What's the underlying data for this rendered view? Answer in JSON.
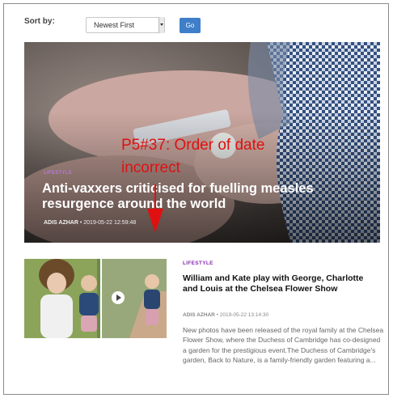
{
  "sort": {
    "label": "Sort by:",
    "selected": "Newest First",
    "go_label": "Go"
  },
  "hero": {
    "category": "LIFESTYLE",
    "title": "Anti-vaxxers criticised for fuelling measles resurgence around the world",
    "author": "ADIS AZHAR",
    "bullet": "•",
    "date": "2019-05-22 12:59:48"
  },
  "annotation": {
    "text": "P5#37: Order of date incorrect",
    "color": "#e01010"
  },
  "article2": {
    "category": "LIFESTYLE",
    "title": "William and Kate play with George, Charlotte and Louis at the Chelsea Flower Show",
    "author": "ADIS AZHAR",
    "bullet": "•",
    "date": "2019-05-22 13:14:30",
    "excerpt": "New photos have been released of the royal family at the Chelsea Flower Show, where the Duchess of Cambridge has co-designed a garden for the prestigious event.The Duchess of Cambridge's garden, Back to Nature, is a family-friendly garden featuring a..."
  },
  "colors": {
    "accent": "#3f7fc9",
    "category": "#8a2bb0"
  }
}
